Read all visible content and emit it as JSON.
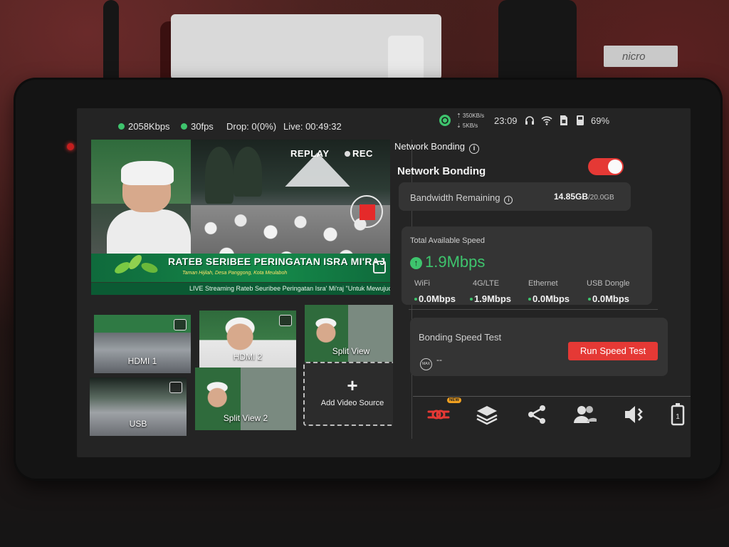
{
  "status_bar": {
    "bitrate": "2058Kbps",
    "fps": "30fps",
    "drop": "Drop: 0(0%)",
    "live": "Live: 00:49:32",
    "upload_rate": "⇡ 350KB/s",
    "download_rate": "⇣ 5KB/s",
    "time": "23:09",
    "battery": "69%"
  },
  "preview": {
    "replay_label": "REPLAY",
    "rec_label": "REC",
    "banner_title": "RATEB SERIBEE PERINGATAN ISRA MI'RAJ",
    "banner_subtitle": "Taman Hijilah, Desa Panggong, Kota Meulaboh",
    "ticker": "LIVE Streaming Rateb Seuribee Peringatan Isra' Mi'raj \"Untuk Mewujud"
  },
  "sources": [
    {
      "label": "HDMI 1"
    },
    {
      "label": "HDMI 2"
    },
    {
      "label": "Split View"
    },
    {
      "label": "USB"
    },
    {
      "label": "Split View 2"
    }
  ],
  "add_source": {
    "plus": "+",
    "label": "Add Video Source"
  },
  "panel": {
    "header": "Network Bonding",
    "title": "Network Bonding",
    "bandwidth_label": "Bandwidth Remaining",
    "bandwidth_used": "14.85GB",
    "bandwidth_total": "/20.0GB",
    "total_speed_label": "Total Available Speed",
    "total_speed": "1.9Mbps",
    "interfaces": [
      {
        "name": "WiFi",
        "value": "0.0Mbps"
      },
      {
        "name": "4G/LTE",
        "value": "1.9Mbps"
      },
      {
        "name": "Ethernet",
        "value": "0.0Mbps"
      },
      {
        "name": "USB Dongle",
        "value": "0.0Mbps"
      }
    ],
    "speed_test_label": "Bonding Speed Test",
    "speed_test_result": "--",
    "max_icon_text": "MAX",
    "run_button": "Run Speed Test"
  },
  "bottom_nav": {
    "new_badge": "NEW",
    "battery_ico_text": "1"
  },
  "device_tag": "nicro",
  "colors": {
    "accent": "#e53935",
    "good": "#3ec46d"
  }
}
